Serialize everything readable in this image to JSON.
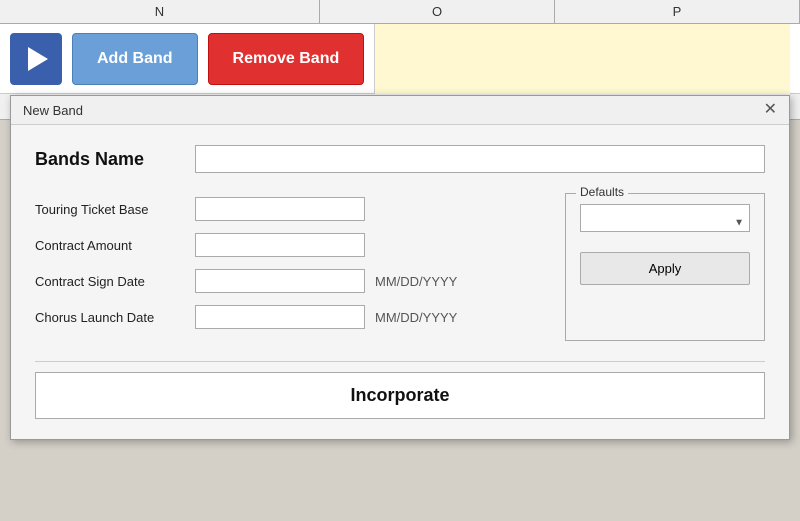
{
  "spreadsheet": {
    "col_n_label": "N",
    "col_o_label": "O",
    "col_p_label": "P"
  },
  "toolbar": {
    "add_band_label": "Add Band",
    "remove_band_label": "Remove Band"
  },
  "dialog": {
    "title": "New Band",
    "close_label": "✕",
    "bands_name_label": "Bands Name",
    "bands_name_placeholder": "",
    "touring_ticket_base_label": "Touring Ticket Base",
    "contract_amount_label": "Contract Amount",
    "contract_sign_date_label": "Contract Sign Date",
    "contract_sign_date_hint": "MM/DD/YYYY",
    "chorus_launch_date_label": "Chorus Launch Date",
    "chorus_launch_date_hint": "MM/DD/YYYY",
    "defaults_legend": "Defaults",
    "apply_label": "Apply",
    "incorporate_label": "Incorporate"
  }
}
